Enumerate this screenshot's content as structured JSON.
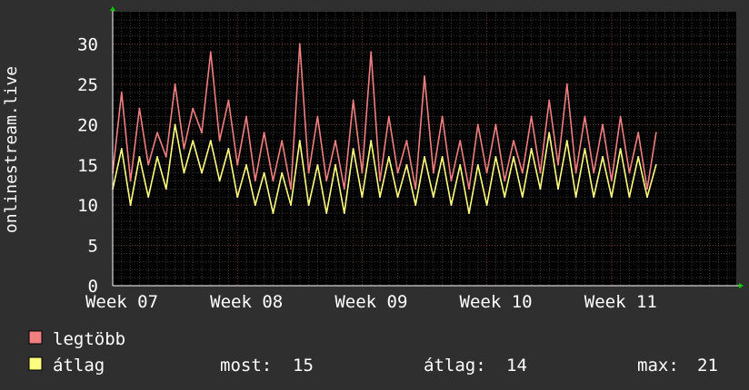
{
  "chart_data": {
    "type": "line",
    "title": "",
    "ylabel": "onlinestream.live",
    "xlabel": "",
    "ylim": [
      0,
      34
    ],
    "yticks": [
      0,
      5,
      10,
      15,
      20,
      25,
      30
    ],
    "xlim": [
      0,
      35
    ],
    "x_ticks": [
      {
        "label": "Week 07",
        "x": 0
      },
      {
        "label": "Week 08",
        "x": 7
      },
      {
        "label": "Week 09",
        "x": 14
      },
      {
        "label": "Week 10",
        "x": 21
      },
      {
        "label": "Week 11",
        "x": 28
      }
    ],
    "grid": true,
    "series": [
      {
        "name": "legtöbb",
        "color": "#f08080",
        "x": [
          0,
          0.5,
          1,
          1.5,
          2,
          2.5,
          3,
          3.5,
          4,
          4.5,
          5,
          5.5,
          6,
          6.5,
          7,
          7.5,
          8,
          8.5,
          9,
          9.5,
          10,
          10.5,
          11,
          11.5,
          12,
          12.5,
          13,
          13.5,
          14,
          14.5,
          15,
          15.5,
          16,
          16.5,
          17,
          17.5,
          18,
          18.5,
          19,
          19.5,
          20,
          20.5,
          21,
          21.5,
          22,
          22.5,
          23,
          23.5,
          24,
          24.5,
          25,
          25.5,
          26,
          26.5,
          27,
          27.5,
          28,
          28.5,
          29,
          29.5,
          30,
          30.5
        ],
        "values": [
          14,
          24,
          13,
          22,
          15,
          19,
          16,
          25,
          17,
          22,
          19,
          29,
          18,
          23,
          15,
          21,
          13,
          19,
          13,
          18,
          12,
          30,
          14,
          21,
          13,
          18,
          12,
          23,
          14,
          29,
          13,
          21,
          14,
          18,
          12,
          26,
          14,
          21,
          13,
          18,
          12,
          20,
          14,
          20,
          13,
          18,
          14,
          21,
          14,
          23,
          15,
          25,
          14,
          21,
          14,
          20,
          13,
          21,
          14,
          19,
          12,
          19
        ]
      },
      {
        "name": "átlag",
        "color": "#ffff80",
        "x": [
          0,
          0.5,
          1,
          1.5,
          2,
          2.5,
          3,
          3.5,
          4,
          4.5,
          5,
          5.5,
          6,
          6.5,
          7,
          7.5,
          8,
          8.5,
          9,
          9.5,
          10,
          10.5,
          11,
          11.5,
          12,
          12.5,
          13,
          13.5,
          14,
          14.5,
          15,
          15.5,
          16,
          16.5,
          17,
          17.5,
          18,
          18.5,
          19,
          19.5,
          20,
          20.5,
          21,
          21.5,
          22,
          22.5,
          23,
          23.5,
          24,
          24.5,
          25,
          25.5,
          26,
          26.5,
          27,
          27.5,
          28,
          28.5,
          29,
          29.5,
          30,
          30.5
        ],
        "values": [
          12,
          17,
          10,
          16,
          11,
          16,
          12,
          20,
          14,
          18,
          14,
          18,
          13,
          17,
          11,
          15,
          10,
          14,
          9,
          14,
          10,
          18,
          10,
          15,
          9,
          15,
          9,
          17,
          11,
          18,
          11,
          16,
          11,
          15,
          10,
          16,
          11,
          16,
          10,
          15,
          9,
          15,
          10,
          16,
          11,
          16,
          11,
          17,
          12,
          19,
          12,
          18,
          11,
          17,
          11,
          16,
          11,
          17,
          11,
          16,
          11,
          15
        ]
      }
    ],
    "legend": {
      "placement": "bottom-left",
      "entries": [
        {
          "label": "legtöbb",
          "color": "#f08080"
        },
        {
          "label": "átlag",
          "color": "#ffff80"
        }
      ]
    },
    "stats": [
      {
        "label": "most:",
        "value": "15"
      },
      {
        "label": "átlag:",
        "value": "14"
      },
      {
        "label": "max:",
        "value": "21"
      }
    ]
  }
}
